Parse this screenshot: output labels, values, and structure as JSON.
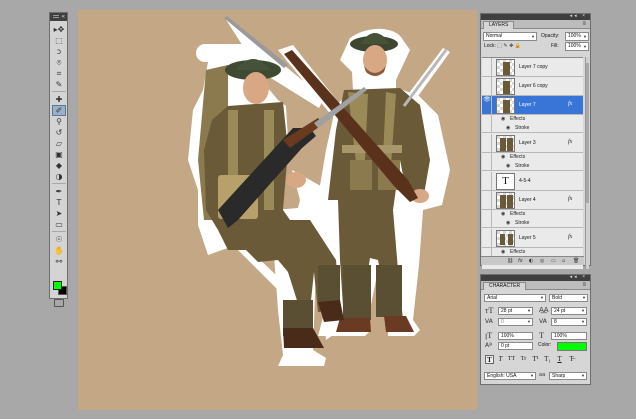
{
  "tools_panel": {
    "collapse_icon": "«",
    "close_icon": "×",
    "tools": [
      {
        "name": "move-tool-icon",
        "glyph": "▸✥"
      },
      {
        "name": "marquee-tool-icon",
        "glyph": "⬚"
      },
      {
        "name": "lasso-tool-icon",
        "glyph": "ↄ"
      },
      {
        "name": "quick-selection-tool-icon",
        "glyph": "⌾"
      },
      {
        "name": "crop-tool-icon",
        "glyph": "⌗"
      },
      {
        "name": "eyedropper-tool-icon",
        "glyph": "✎"
      },
      {
        "name": "healing-brush-tool-icon",
        "glyph": "✚"
      },
      {
        "name": "brush-tool-icon",
        "glyph": "✐"
      },
      {
        "name": "clone-stamp-tool-icon",
        "glyph": "⚲"
      },
      {
        "name": "history-brush-tool-icon",
        "glyph": "↺"
      },
      {
        "name": "eraser-tool-icon",
        "glyph": "▱"
      },
      {
        "name": "gradient-tool-icon",
        "glyph": "▣"
      },
      {
        "name": "blur-tool-icon",
        "glyph": "◆"
      },
      {
        "name": "dodge-tool-icon",
        "glyph": "◑"
      },
      {
        "name": "pen-tool-icon",
        "glyph": "✒"
      },
      {
        "name": "type-tool-icon",
        "glyph": "T"
      },
      {
        "name": "path-selection-tool-icon",
        "glyph": "➤"
      },
      {
        "name": "shape-tool-icon",
        "glyph": "▭"
      },
      {
        "name": "3d-rotate-tool-icon",
        "glyph": "☉"
      },
      {
        "name": "hand-tool-icon",
        "glyph": "✋"
      },
      {
        "name": "zoom-tool-icon",
        "glyph": "⚯"
      }
    ],
    "foreground_color": "#00ff00",
    "background_color": "#000000"
  },
  "canvas": {
    "background_color": "#c4a886"
  },
  "layers_panel": {
    "tab_label": "LAYERS",
    "menu_icon": "≡",
    "blend_mode": "Normal",
    "opacity_label": "Opacity:",
    "opacity_value": "100%",
    "lock_label": "Lock:",
    "lock_icons": "⬚ ✎ ✥ 🔒",
    "fill_label": "Fill:",
    "fill_value": "100%",
    "layers": [
      {
        "name": "Layer 7 copy",
        "visible": false,
        "selected": false,
        "fx": false
      },
      {
        "name": "Layer 6 copy",
        "visible": false,
        "selected": false,
        "fx": false
      },
      {
        "name": "Layer 7",
        "visible": true,
        "selected": true,
        "fx": true,
        "effects_label": "Effects",
        "effect": "Stroke"
      },
      {
        "name": "Layer 3",
        "visible": false,
        "selected": false,
        "fx": true,
        "effects_label": "Effects",
        "effect": "Stroke"
      },
      {
        "name": "4-5-4",
        "visible": false,
        "selected": false,
        "fx": false,
        "type_layer": true
      },
      {
        "name": "Layer 4",
        "visible": false,
        "selected": false,
        "fx": true,
        "effects_label": "Effects",
        "effect": "Stroke"
      },
      {
        "name": "Layer 5",
        "visible": false,
        "selected": false,
        "fx": true,
        "effects_label": "Effects",
        "effect": ""
      }
    ],
    "fx_label": "fx",
    "type_thumb": "T",
    "footer_icons": [
      "⛓",
      "fx",
      "◐",
      "◎",
      "▭",
      "▫",
      "🗑"
    ]
  },
  "character_panel": {
    "tab_label": "CHARACTER",
    "menu_icon": "≡",
    "font_family": "Arial",
    "font_style": "Bold",
    "font_size": "28 pt",
    "leading": "24 pt",
    "kerning": "0",
    "tracking": "8",
    "vertical_scale": "100%",
    "horizontal_scale": "100%",
    "baseline_shift": "0 pt",
    "color_label": "Color:",
    "color_value": "#00ff00",
    "style_buttons": [
      "T",
      "T",
      "TT",
      "Tr",
      "T¹",
      "T₁",
      "T",
      "T̶"
    ],
    "language": "English: USA",
    "aa_icon": "aa",
    "antialias": "Sharp"
  }
}
